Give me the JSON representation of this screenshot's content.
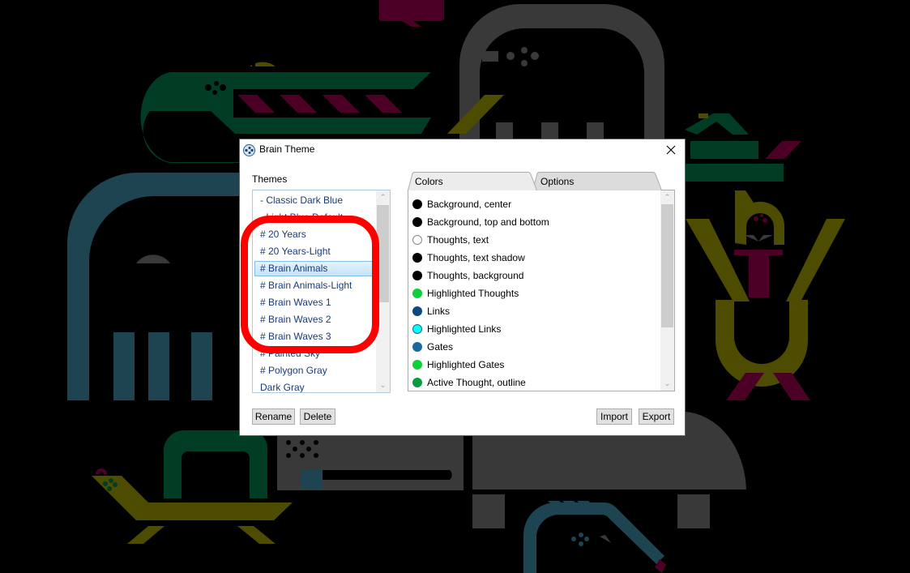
{
  "dialog": {
    "title": "Brain Theme",
    "close_icon": "close-icon",
    "app_icon": "brain-app-icon"
  },
  "themes": {
    "label": "Themes",
    "items": [
      {
        "label": "- Classic Dark Blue",
        "selected": false
      },
      {
        "label": "- Light Blue Default",
        "selected": false
      },
      {
        "label": "# 20 Years",
        "selected": false
      },
      {
        "label": "# 20 Years-Light",
        "selected": false
      },
      {
        "label": "# Brain Animals",
        "selected": true
      },
      {
        "label": "# Brain Animals-Light",
        "selected": false
      },
      {
        "label": "# Brain Waves 1",
        "selected": false
      },
      {
        "label": "# Brain Waves 2",
        "selected": false
      },
      {
        "label": "# Brain Waves 3",
        "selected": false
      },
      {
        "label": "# Painted Sky",
        "selected": false
      },
      {
        "label": "# Polygon Gray",
        "selected": false
      },
      {
        "label": "Dark Gray",
        "selected": false
      }
    ]
  },
  "tabs": [
    {
      "label": "Colors",
      "active": true
    },
    {
      "label": "Options",
      "active": false
    }
  ],
  "colors": {
    "items": [
      {
        "label": "Background, center",
        "color": "#000000"
      },
      {
        "label": "Background, top and bottom",
        "color": "#000000"
      },
      {
        "label": "Thoughts, text",
        "color": "#ffffff"
      },
      {
        "label": "Thoughts, text shadow",
        "color": "#000000"
      },
      {
        "label": "Thoughts, background",
        "color": "#000000"
      },
      {
        "label": "Highlighted Thoughts",
        "color": "#0fcf3a"
      },
      {
        "label": "Links",
        "color": "#0a4a80"
      },
      {
        "label": "Highlighted Links",
        "color": "#00ffff"
      },
      {
        "label": "Gates",
        "color": "#1a6aa0"
      },
      {
        "label": "Highlighted Gates",
        "color": "#0fcf3a"
      },
      {
        "label": "Active Thought, outline",
        "color": "#0a9a40"
      }
    ]
  },
  "buttons": {
    "rename": "Rename",
    "delete": "Delete",
    "import": "Import",
    "export": "Export"
  },
  "annotation": {
    "color": "#ff0000"
  },
  "background_palette": {
    "green": "#003d24",
    "olive": "#4d4c00",
    "maroon": "#4d0026",
    "teal": "#1d4450",
    "gray": "#393939"
  }
}
